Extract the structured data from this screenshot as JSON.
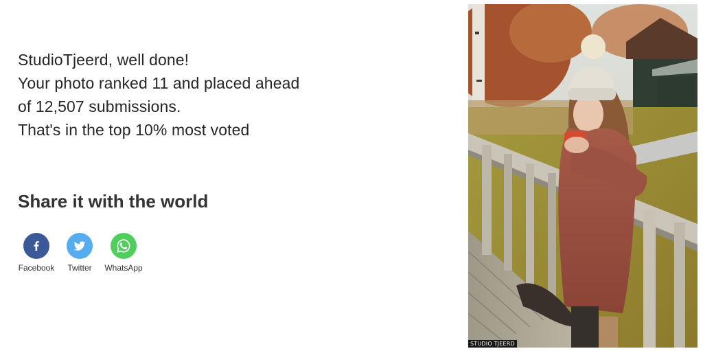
{
  "message": {
    "line1": "StudioTjeerd, well done!",
    "line2": "Your photo ranked 11 and placed ahead",
    "line3": "of 12,507 submissions.",
    "line4": "That's in the top 10% most voted"
  },
  "share": {
    "title": "Share it with the world",
    "buttons": [
      {
        "label": "Facebook",
        "icon": "facebook-icon",
        "color": "#3b5998"
      },
      {
        "label": "Twitter",
        "icon": "twitter-icon",
        "color": "#55acee"
      },
      {
        "label": "WhatsApp",
        "icon": "whatsapp-icon",
        "color": "#4fce5d"
      }
    ]
  },
  "photo": {
    "watermark": "STUDIO TJEERD"
  }
}
